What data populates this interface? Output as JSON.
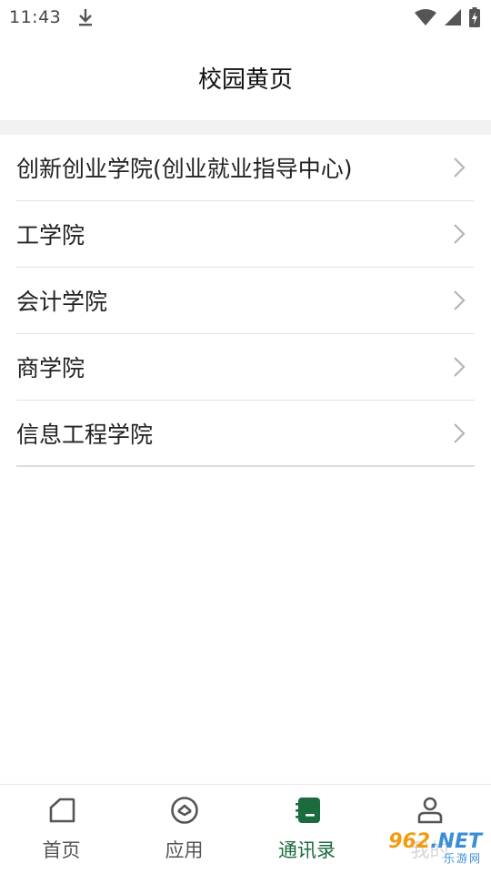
{
  "status": {
    "time": "11:43",
    "icons": [
      "download-icon",
      "wifi-icon",
      "signal-icon",
      "battery-charging-icon"
    ]
  },
  "header": {
    "title": "校园黄页"
  },
  "list": {
    "items": [
      {
        "label": "创新创业学院(创业就业指导中心)"
      },
      {
        "label": "工学院"
      },
      {
        "label": "会计学院"
      },
      {
        "label": "商学院"
      },
      {
        "label": "信息工程学院"
      }
    ]
  },
  "bottom_nav": {
    "items": [
      {
        "label": "首页",
        "icon": "home-icon"
      },
      {
        "label": "应用",
        "icon": "apps-icon"
      },
      {
        "label": "通讯录",
        "icon": "contacts-book-icon",
        "active": true
      },
      {
        "label": "我的",
        "icon": "person-icon"
      }
    ]
  },
  "watermark": {
    "brand_num": "962",
    "brand_net": ".NET",
    "brand_sub": "乐游网"
  },
  "colors": {
    "accent": "#1c6b3c",
    "divider": "#f2f2f2",
    "chevron": "#b5b5b5"
  }
}
